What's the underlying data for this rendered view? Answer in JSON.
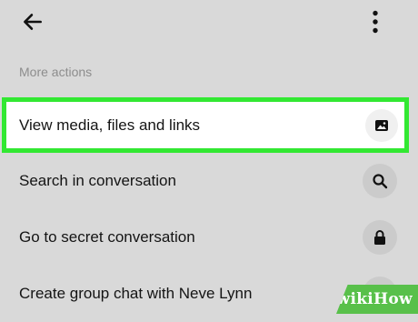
{
  "header": {
    "back_icon": "arrow-left-icon",
    "menu_icon": "vertical-dots-icon"
  },
  "section": {
    "title": "More actions"
  },
  "actions": [
    {
      "label": "View media, files and links",
      "icon": "image-icon",
      "highlighted": true
    },
    {
      "label": "Search in conversation",
      "icon": "search-icon",
      "highlighted": false
    },
    {
      "label": "Go to secret conversation",
      "icon": "lock-icon",
      "highlighted": false
    },
    {
      "label": "Create group chat with Neve Lynn",
      "icon": "group-icon",
      "highlighted": false
    }
  ],
  "watermark": {
    "text": "wikiHow"
  },
  "colors": {
    "background": "#d9d9d9",
    "highlight_border": "#32e832",
    "watermark_green": "#58c04a"
  }
}
